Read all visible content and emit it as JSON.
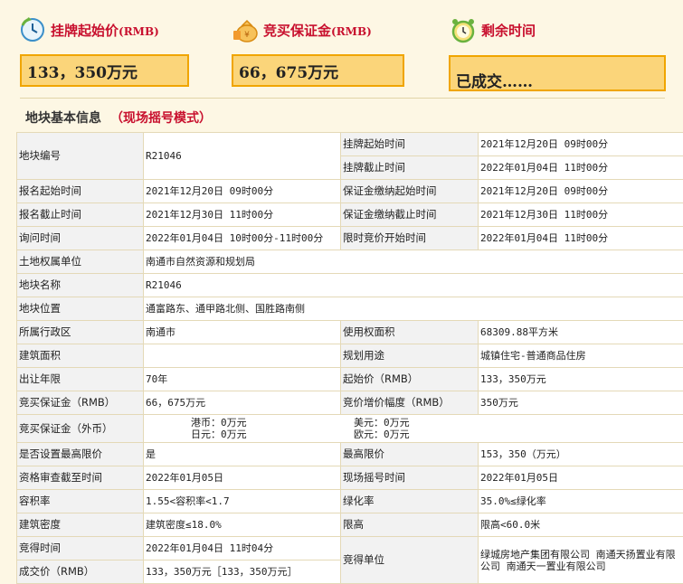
{
  "header": {
    "start_price_label": "挂牌起始价",
    "start_price_unit": "(RMB)",
    "start_price_value": "133，350万元",
    "deposit_label": "竞买保证金",
    "deposit_unit": "(RMB)",
    "deposit_value": "66，675万元",
    "remaining_label": "剩余时间",
    "remaining_value": "已成交……"
  },
  "section": {
    "title": "地块基本信息",
    "mode": "（现场摇号模式）"
  },
  "rows": {
    "plot_no_k": "地块编号",
    "plot_no_v": "R21046",
    "list_start_k": "挂牌起始时间",
    "list_start_v": "2021年12月20日 09时00分",
    "list_end_k": "挂牌截止时间",
    "list_end_v": "2022年01月04日 11时00分",
    "reg_start_k": "报名起始时间",
    "reg_start_v": "2021年12月20日 09时00分",
    "dep_start_k": "保证金缴纳起始时间",
    "dep_start_v": "2021年12月20日 09时00分",
    "reg_end_k": "报名截止时间",
    "reg_end_v": "2021年12月30日 11时00分",
    "dep_end_k": "保证金缴纳截止时间",
    "dep_end_v": "2021年12月30日 11时00分",
    "inquiry_k": "询问时间",
    "inquiry_v": "2022年01月04日 10时00分-11时00分",
    "bid_start_k": "限时竞价开始时间",
    "bid_start_v": "2022年01月04日 11时00分",
    "owner_k": "土地权属单位",
    "owner_v": "南通市自然资源和规划局",
    "name_k": "地块名称",
    "name_v": "R21046",
    "loc_k": "地块位置",
    "loc_v": "通富路东、通甲路北侧、国胜路南侧",
    "district_k": "所属行政区",
    "district_v": "南通市",
    "area_k": "使用权面积",
    "area_v": "68309.88平方米",
    "build_area_k": "建筑面积",
    "build_area_v": "",
    "use_k": "规划用途",
    "use_v": "城镇住宅-普通商品住房",
    "years_k": "出让年限",
    "years_v": "70年",
    "start_price_k": "起始价（RMB）",
    "start_price_v": "133，350万元",
    "deposit_k": "竞买保证金（RMB）",
    "deposit_v": "66，675万元",
    "increment_k": "竞价增价幅度（RMB）",
    "increment_v": "350万元",
    "fx_k": "竞买保证金（外币）",
    "fx_hkd": "港币：0万元",
    "fx_usd": "美元：0万元",
    "fx_jpy": "日元：0万元",
    "fx_eur": "欧元：0万元",
    "cap_k": "是否设置最高限价",
    "cap_v": "是",
    "max_k": "最高限价",
    "max_v": "153，350（万元）",
    "qual_k": "资格审查截至时间",
    "qual_v": "2022年01月05日",
    "lottery_k": "现场摇号时间",
    "lottery_v": "2022年01月05日",
    "far_k": "容积率",
    "far_v": "1.55<容积率<1.7",
    "green_k": "绿化率",
    "green_v": "35.0%≤绿化率",
    "density_k": "建筑密度",
    "density_v": "建筑密度≤18.0%",
    "height_k": "限高",
    "height_v": "限高<60.0米",
    "win_time_k": "竞得时间",
    "win_time_v": "2022年01月04日 11时04分",
    "deal_k": "成交价（RMB）",
    "deal_v": "133，350万元［133，350万元］",
    "winner_k": "竞得单位",
    "winner_v": "绿城房地产集团有限公司 南通天扬置业有限公司 南通天一置业有限公司"
  },
  "colors": {
    "accent_red": "#c8102e",
    "value_box_fill": "#fbd57a",
    "value_box_border": "#f0a500"
  }
}
